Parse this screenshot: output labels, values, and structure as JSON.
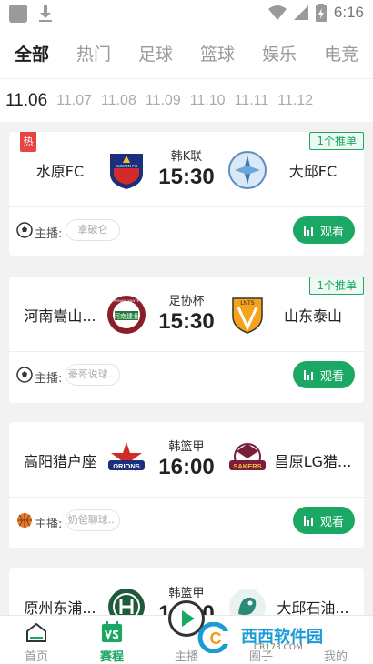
{
  "status_bar": {
    "time": "6:16"
  },
  "tabs": [
    "全部",
    "热门",
    "足球",
    "篮球",
    "娱乐",
    "电竞"
  ],
  "dates": [
    "11.06",
    "11.07",
    "11.08",
    "11.09",
    "11.10",
    "11.11",
    "11.12"
  ],
  "anchor_label": "主播:",
  "watch_label": "观看",
  "matches": [
    {
      "home": "水原FC",
      "away": "大邱FC",
      "league": "韩K联",
      "time": "15:30",
      "anchor": "拿破仑",
      "badge": "1个推单",
      "hot": "热",
      "sport": "football-icon"
    },
    {
      "home": "河南嵩山...",
      "away": "山东泰山",
      "league": "足协杯",
      "time": "15:30",
      "anchor": "豪哥说球...",
      "badge": "1个推单",
      "sport": "football-icon"
    },
    {
      "home": "高阳猎户座",
      "away": "昌原LG猎...",
      "league": "韩篮甲",
      "time": "16:00",
      "anchor": "奶爸聊球...",
      "sport": "basketball-icon"
    },
    {
      "home": "原州东浦...",
      "away": "大邱石油...",
      "league": "韩篮甲",
      "time": "1_:_0"
    }
  ],
  "nav": [
    "首页",
    "赛程",
    "主播",
    "圈子",
    "我的"
  ],
  "watermark": {
    "text": "西西软件园",
    "url": "CR173.COM",
    "logo_letter": "C"
  },
  "logo_texts": {
    "suwon": "SUWON FC",
    "henan": "HENAN JIANYE",
    "henan_cn": "河南建业",
    "shandong": "LNTS",
    "orions": "ORIONS",
    "sakers": "SAKERS"
  },
  "colors": {
    "accent": "#1aa864",
    "hot": "#e84343"
  }
}
